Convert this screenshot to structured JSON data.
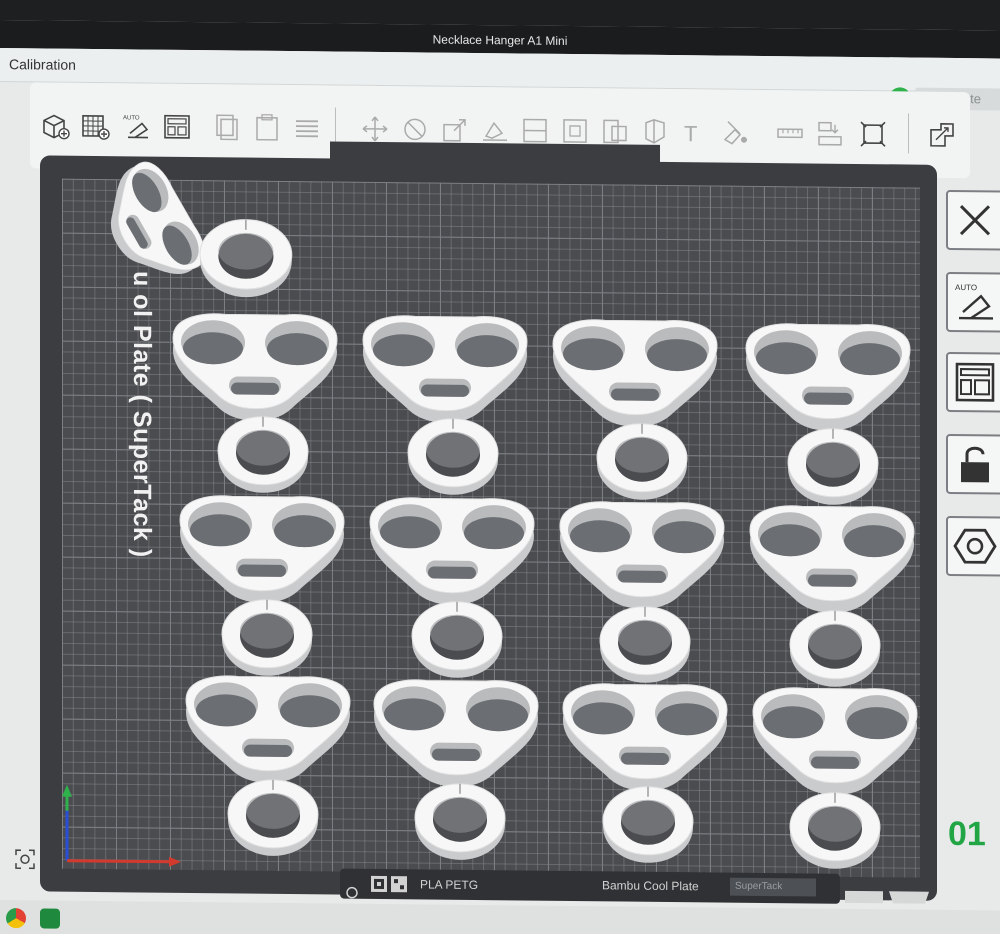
{
  "window": {
    "title": "Necklace Hanger A1 Mini"
  },
  "menu": {
    "calibration_label": "Calibration"
  },
  "slice": {
    "button_label": "Slice plate",
    "toggle_symbol": "⌄"
  },
  "toolbar": {
    "icons": [
      "add-object-icon",
      "add-plate-icon",
      "auto-orient-icon",
      "arrange-icon",
      "copy-icon",
      "paste-icon",
      "layers-icon",
      "move-icon",
      "rotate-icon",
      "scale-icon",
      "lay-on-face-icon",
      "split-icon",
      "cut-icon",
      "boolean-icon",
      "text-icon",
      "paint-icon",
      "measure-icon",
      "assembly-icon",
      "fit-icon",
      "assembly-view-icon"
    ]
  },
  "plate": {
    "label": "B  u  ol Plate ( SuperTack )",
    "filament_type": "PLA PETG",
    "plate_type": "Bambu Cool Plate",
    "plate_subtype": "SuperTack"
  },
  "right_panel": {
    "buttons": [
      "close-icon",
      "auto-arrange-icon",
      "layout-icon",
      "lock-icon",
      "settings-hex-icon"
    ],
    "counter_text": "01"
  },
  "colors": {
    "accent_green": "#2fb24c",
    "bed": "#4a4c50",
    "object": "#ffffff"
  }
}
